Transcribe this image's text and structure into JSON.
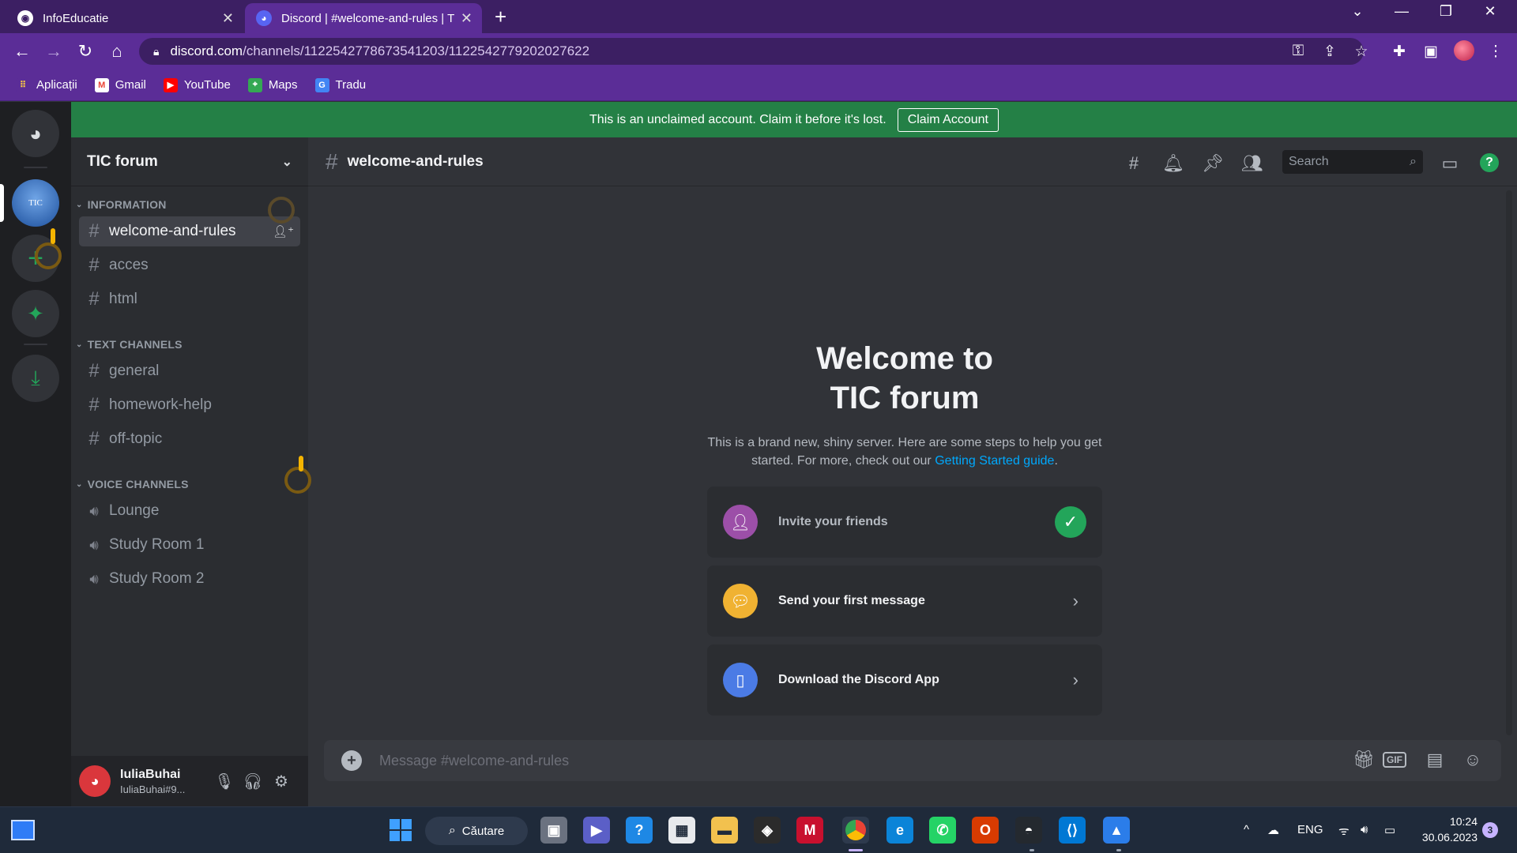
{
  "browser": {
    "tabs": [
      {
        "title": "InfoEducatie",
        "favicon": "globe-icon"
      },
      {
        "title": "Discord | #welcome-and-rules | T",
        "favicon": "discord-icon",
        "active": true
      }
    ],
    "url_host": "discord.com",
    "url_path": "/channels/1122542778673541203/1122542779202027622",
    "bookmarks": [
      {
        "label": "Aplicații",
        "icon": "apps-grid-icon"
      },
      {
        "label": "Gmail",
        "icon": "gmail-icon"
      },
      {
        "label": "YouTube",
        "icon": "youtube-icon"
      },
      {
        "label": "Maps",
        "icon": "maps-icon"
      },
      {
        "label": "Tradu",
        "icon": "translate-icon"
      }
    ]
  },
  "banner": {
    "text": "This is an unclaimed account. Claim it before it's lost.",
    "button": "Claim Account"
  },
  "server": {
    "name": "TIC forum",
    "icon_text": "TIC",
    "categories": [
      {
        "name": "INFORMATION",
        "channels": [
          {
            "name": "welcome-and-rules",
            "type": "text",
            "active": true
          },
          {
            "name": "acces",
            "type": "text"
          },
          {
            "name": "html",
            "type": "text"
          }
        ]
      },
      {
        "name": "TEXT CHANNELS",
        "channels": [
          {
            "name": "general",
            "type": "text"
          },
          {
            "name": "homework-help",
            "type": "text"
          },
          {
            "name": "off-topic",
            "type": "text"
          }
        ]
      },
      {
        "name": "VOICE CHANNELS",
        "channels": [
          {
            "name": "Lounge",
            "type": "voice"
          },
          {
            "name": "Study Room 1",
            "type": "voice"
          },
          {
            "name": "Study Room 2",
            "type": "voice"
          }
        ]
      }
    ]
  },
  "user": {
    "name": "IuliaBuhai",
    "tag": "IuliaBuhai#9..."
  },
  "chat": {
    "channel": "welcome-and-rules",
    "search_placeholder": "Search",
    "welcome_line1": "Welcome to",
    "welcome_line2": "TIC forum",
    "welcome_sub1": "This is a brand new, shiny server. Here are some steps to help you get started. For more, check out our",
    "welcome_link": "Getting Started guide",
    "welcome_end": ".",
    "cards": [
      {
        "label": "Invite your friends",
        "done": true
      },
      {
        "label": "Send your first message",
        "done": false
      },
      {
        "label": "Download the Discord App",
        "done": false
      }
    ],
    "composer_placeholder": "Message #welcome-and-rules",
    "gif_label": "GIF"
  },
  "taskbar": {
    "search_label": "Căutare",
    "lang": "ENG",
    "time": "10:24",
    "date": "30.06.2023",
    "notifications": "3"
  },
  "colors": {
    "accent": "#5865f2",
    "online": "#23a55a",
    "banner": "#248046",
    "link": "#00a8fc"
  }
}
